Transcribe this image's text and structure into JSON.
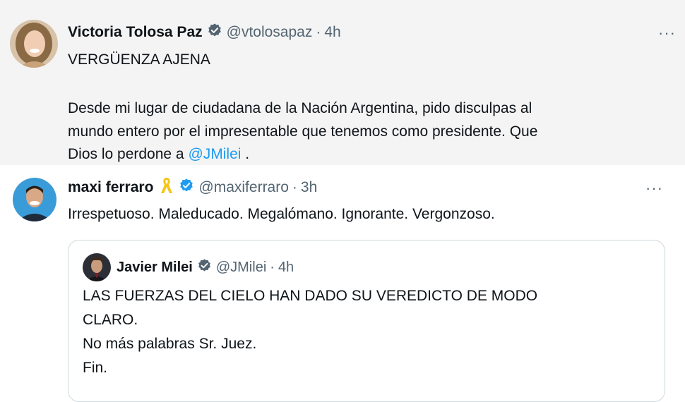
{
  "tweets": [
    {
      "author": {
        "name": "Victoria Tolosa Paz",
        "handle": "@vtolosapaz",
        "verified": true
      },
      "separator": "·",
      "time": "4h",
      "lines": [
        "VERGÜENZA AJENA",
        "Desde mi lugar de ciudadana de la Nación Argentina, pido disculpas al",
        "mundo entero por el impresentable que tenemos como presidente. Que"
      ],
      "last_line_prefix": "Dios lo perdone a ",
      "mention": "@JMilei",
      "last_line_suffix": " .",
      "more_label": "···"
    },
    {
      "author": {
        "name": "maxi ferraro",
        "handle": "@maxiferraro",
        "verified": true,
        "ribbon_icon": "yellow-ribbon-icon"
      },
      "separator": "·",
      "time": "3h",
      "text": "Irrespetuoso. Maleducado. Megalómano. Ignorante. Vergonzoso.",
      "more_label": "···",
      "quoted": {
        "author": {
          "name": "Javier Milei",
          "handle": "@JMilei",
          "verified": true
        },
        "separator": "·",
        "time": "4h",
        "lines": [
          "LAS FUERZAS DEL CIELO HAN DADO SU VEREDICTO DE MODO",
          "CLARO.",
          "No más palabras Sr. Juez.",
          "Fin."
        ]
      }
    }
  ],
  "colors": {
    "verified": "#1d9bf0",
    "mention": "#1d9bf0",
    "ribbon": "#f5c518",
    "muted": "#536471"
  }
}
